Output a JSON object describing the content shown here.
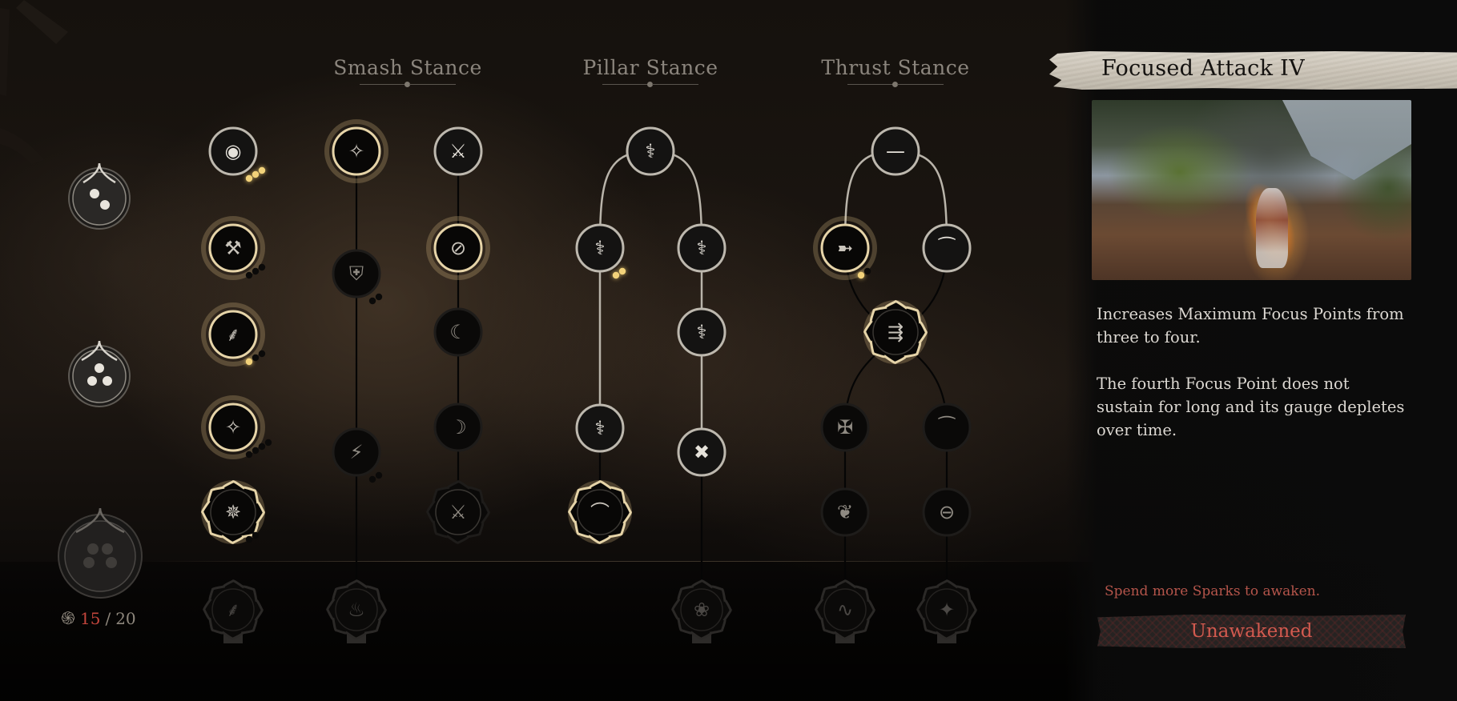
{
  "stances": [
    {
      "id": "smash",
      "title": "Smash Stance"
    },
    {
      "id": "pillar",
      "title": "Pillar Stance"
    },
    {
      "id": "thrust",
      "title": "Thrust Stance"
    }
  ],
  "focus_orbs": [
    {
      "id": "focus-orb-2",
      "points": 2,
      "state": "unlocked"
    },
    {
      "id": "focus-orb-3",
      "points": 3,
      "state": "unlocked"
    },
    {
      "id": "focus-orb-4",
      "points": 4,
      "state": "locked"
    }
  ],
  "sparks": {
    "icon": "spark-icon",
    "current": "15",
    "separator": "/",
    "max": "20"
  },
  "colors": {
    "unlocked_ring": "#bdb8ae",
    "glow_ring": "#e6d4a8",
    "locked_ring": "#2b2927",
    "spark_dot_lit": "#f2d27a",
    "spark_dot_unlit": "#0b0a09",
    "alert_red": "#d25a4f",
    "hint_red": "#b5554b"
  },
  "skill_nodes": [
    {
      "id": "n1",
      "col": "smash-a",
      "icon": "flame-eye-icon",
      "state": "unlocked",
      "shape": "circle",
      "dots_lit": 3,
      "dots_total": 3
    },
    {
      "id": "n2",
      "col": "smash-a",
      "icon": "staff-strike-icon",
      "state": "glowing",
      "shape": "circle",
      "dots_lit": 0,
      "dots_total": 3
    },
    {
      "id": "n3",
      "col": "smash-a",
      "icon": "sweep-staff-icon",
      "state": "glowing",
      "shape": "circle",
      "dots_lit": 1,
      "dots_total": 3
    },
    {
      "id": "n4",
      "col": "smash-a",
      "icon": "smash-swirl-icon",
      "state": "glowing",
      "shape": "circle",
      "dots_lit": 0,
      "dots_total": 4
    },
    {
      "id": "n5",
      "col": "smash-a",
      "icon": "heavy-smash-icon",
      "state": "glowing",
      "shape": "scalloped",
      "dots_lit": 0,
      "dots_total": 2
    },
    {
      "id": "n6",
      "col": "smash-a",
      "icon": "sweep-staff-icon",
      "state": "locked",
      "shape": "scalloped-pedestal",
      "dots_lit": 0,
      "dots_total": 0
    },
    {
      "id": "n7",
      "col": "smash-b",
      "icon": "smash-swirl-icon",
      "state": "glowing",
      "shape": "circle",
      "dots_lit": 0,
      "dots_total": 0
    },
    {
      "id": "n8",
      "col": "smash-b",
      "icon": "shield-smash-icon",
      "state": "dark",
      "shape": "circle",
      "dots_lit": 0,
      "dots_total": 2
    },
    {
      "id": "n9",
      "col": "smash-b",
      "icon": "crack-smash-icon",
      "state": "dark",
      "shape": "circle",
      "dots_lit": 0,
      "dots_total": 2
    },
    {
      "id": "n10",
      "col": "smash-b",
      "icon": "fire-staff-icon",
      "state": "locked",
      "shape": "scalloped-pedestal",
      "dots_lit": 0,
      "dots_total": 0
    },
    {
      "id": "n11",
      "col": "smash-c",
      "icon": "staff-spark-icon",
      "state": "unlocked",
      "shape": "circle",
      "dots_lit": 0,
      "dots_total": 0
    },
    {
      "id": "n12",
      "col": "smash-c",
      "icon": "spin-slash-icon",
      "state": "glowing",
      "shape": "circle",
      "dots_lit": 0,
      "dots_total": 0
    },
    {
      "id": "n13",
      "col": "smash-c",
      "icon": "crescent-icon",
      "state": "dark",
      "shape": "circle",
      "dots_lit": 0,
      "dots_total": 0
    },
    {
      "id": "n14",
      "col": "smash-c",
      "icon": "crescent-flame-icon",
      "state": "dark",
      "shape": "circle",
      "dots_lit": 0,
      "dots_total": 0
    },
    {
      "id": "n15",
      "col": "smash-c",
      "icon": "crossed-staff-flame-icon",
      "state": "dark",
      "shape": "scalloped",
      "dots_lit": 0,
      "dots_total": 0
    },
    {
      "id": "n16",
      "col": "pillar-top",
      "icon": "pillar-staff-icon",
      "state": "unlocked",
      "shape": "circle",
      "dots_lit": 0,
      "dots_total": 0
    },
    {
      "id": "n17",
      "col": "pillar-a",
      "icon": "pillar-grass-icon",
      "state": "unlocked",
      "shape": "circle",
      "dots_lit": 2,
      "dots_total": 2
    },
    {
      "id": "n18",
      "col": "pillar-a",
      "icon": "pillar-leap-icon",
      "state": "unlocked",
      "shape": "circle",
      "dots_lit": 0,
      "dots_total": 0
    },
    {
      "id": "n19",
      "col": "pillar-a",
      "icon": "pillar-sweep-icon",
      "state": "glowing",
      "shape": "scalloped",
      "dots_lit": 0,
      "dots_total": 0
    },
    {
      "id": "n20",
      "col": "pillar-b",
      "icon": "pillar-spin-icon",
      "state": "unlocked",
      "shape": "circle",
      "dots_lit": 0,
      "dots_total": 0
    },
    {
      "id": "n21",
      "col": "pillar-b",
      "icon": "pillar-whirl-icon",
      "state": "unlocked",
      "shape": "circle",
      "dots_lit": 0,
      "dots_total": 0
    },
    {
      "id": "n22",
      "col": "pillar-b",
      "icon": "cross-staffs-icon",
      "state": "unlocked",
      "shape": "circle",
      "dots_lit": 0,
      "dots_total": 0
    },
    {
      "id": "n23",
      "col": "pillar-b",
      "icon": "pinwheel-icon",
      "state": "locked",
      "shape": "scalloped-pedestal",
      "dots_lit": 0,
      "dots_total": 0
    },
    {
      "id": "n24",
      "col": "thrust-top",
      "icon": "thrust-line-icon",
      "state": "unlocked",
      "shape": "circle",
      "dots_lit": 0,
      "dots_total": 0
    },
    {
      "id": "n25",
      "col": "thrust-a",
      "icon": "thrust-dash-icon",
      "state": "glowing",
      "shape": "circle",
      "dots_lit": 1,
      "dots_total": 2
    },
    {
      "id": "n26",
      "col": "thrust-b",
      "icon": "thrust-arc-icon",
      "state": "unlocked",
      "shape": "circle",
      "dots_lit": 0,
      "dots_total": 0
    },
    {
      "id": "n27",
      "col": "thrust-mid",
      "icon": "focused-attack-icon",
      "state": "selected",
      "shape": "scalloped",
      "dots_lit": 0,
      "dots_total": 0
    },
    {
      "id": "n28",
      "col": "thrust-a",
      "icon": "thrust-cross-icon",
      "state": "dark",
      "shape": "circle",
      "dots_lit": 0,
      "dots_total": 0
    },
    {
      "id": "n29",
      "col": "thrust-a",
      "icon": "thrust-feather-icon",
      "state": "dark",
      "shape": "circle",
      "dots_lit": 0,
      "dots_total": 0
    },
    {
      "id": "n30",
      "col": "thrust-a",
      "icon": "thrust-wave-icon",
      "state": "locked",
      "shape": "scalloped-pedestal",
      "dots_lit": 0,
      "dots_total": 0
    },
    {
      "id": "n31",
      "col": "thrust-b",
      "icon": "thrust-loop-icon",
      "state": "dark",
      "shape": "circle",
      "dots_lit": 0,
      "dots_total": 0
    },
    {
      "id": "n32",
      "col": "thrust-b",
      "icon": "thrust-ring-icon",
      "state": "dark",
      "shape": "circle",
      "dots_lit": 0,
      "dots_total": 0
    },
    {
      "id": "n33",
      "col": "thrust-b",
      "icon": "thrust-star-icon",
      "state": "locked",
      "shape": "scalloped-pedestal",
      "dots_lit": 0,
      "dots_total": 0
    }
  ],
  "detail": {
    "title": "Focused Attack IV",
    "preview_alt": "skill preview: fighter with flaming staff on a dirt path",
    "description": [
      "Increases Maximum Focus Points from three to four.",
      "The fourth Focus Point does not sustain for long and its gauge depletes over time."
    ],
    "hint": "Spend more Sparks to awaken.",
    "action_label": "Unawakened"
  }
}
